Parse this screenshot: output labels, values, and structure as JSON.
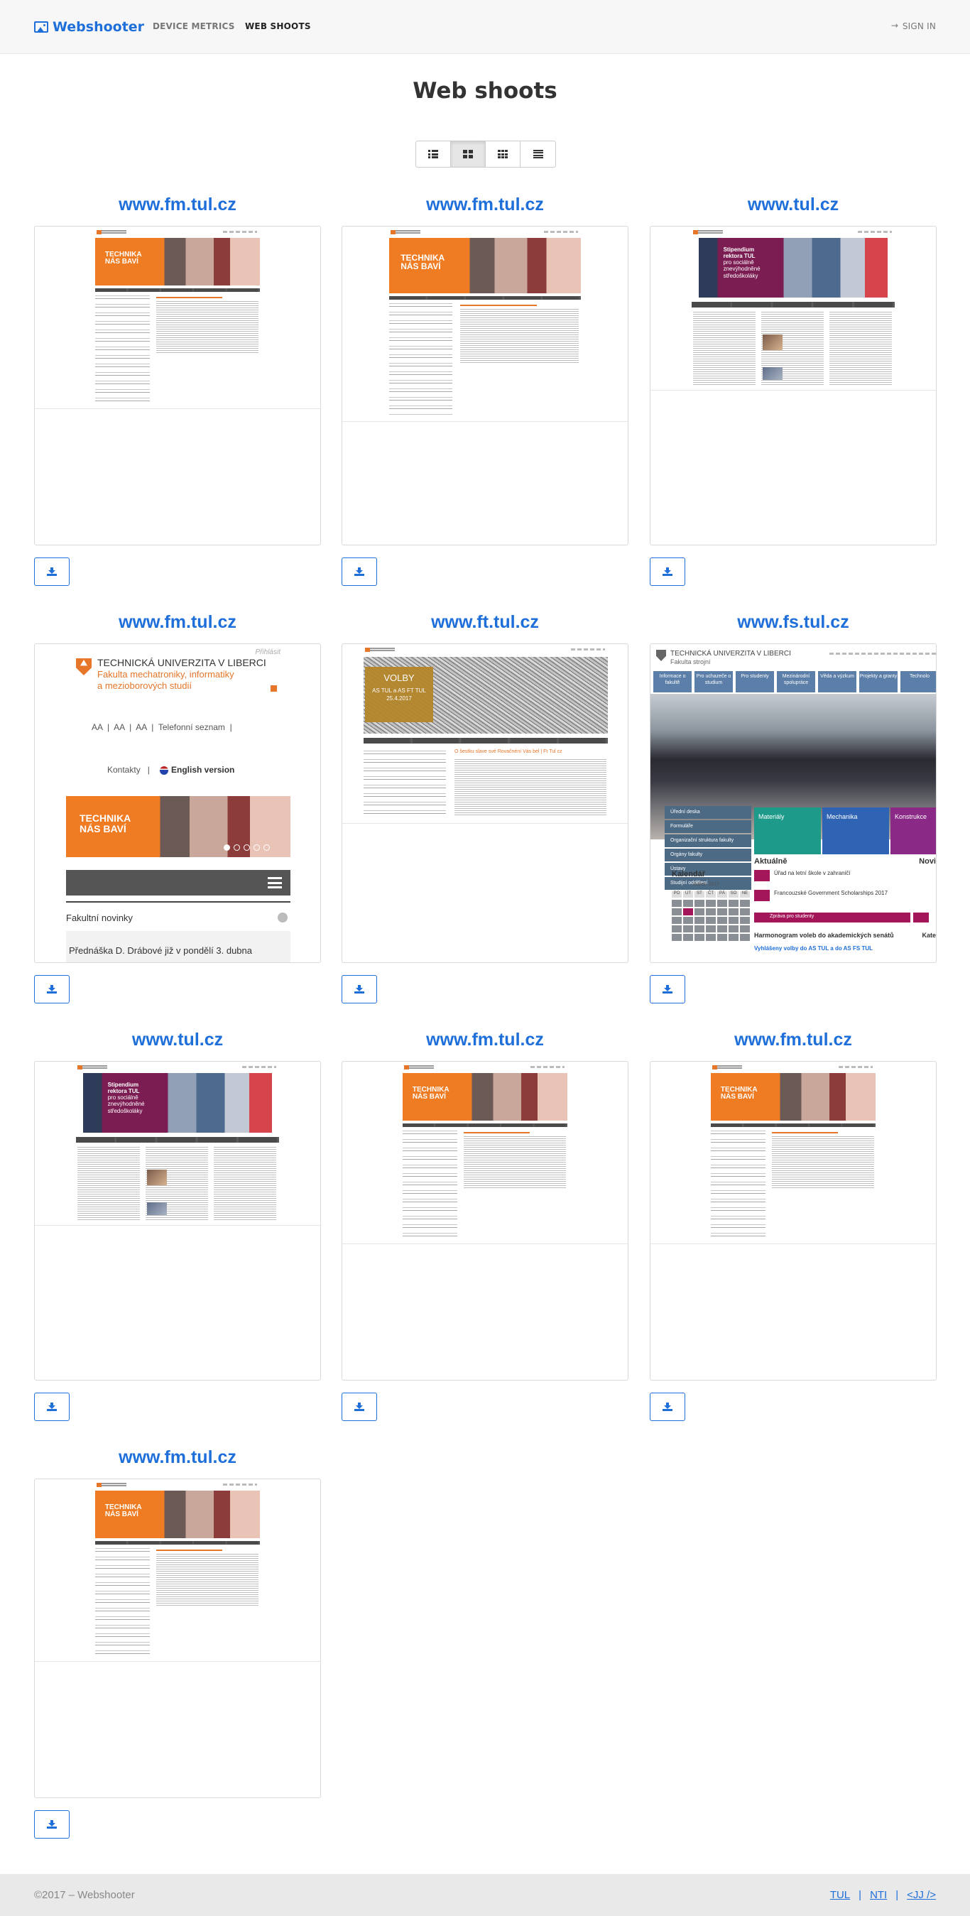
{
  "nav": {
    "brand": "Webshooter",
    "links": [
      {
        "label": "DEVICE METRICS"
      },
      {
        "label": "WEB SHOOTS"
      }
    ],
    "signin": "SIGN IN"
  },
  "page": {
    "title": "Web shoots"
  },
  "view_toggle": {
    "options": [
      "list",
      "grid-2",
      "grid-3",
      "lines"
    ],
    "selected": "grid-2"
  },
  "shoots": [
    {
      "title": "www.fm.tul.cz",
      "preview": "fm-desktop-small"
    },
    {
      "title": "www.fm.tul.cz",
      "preview": "fm-desktop"
    },
    {
      "title": "www.tul.cz",
      "preview": "tul-desktop"
    },
    {
      "title": "www.fm.tul.cz",
      "preview": "fm-mobile"
    },
    {
      "title": "www.ft.tul.cz",
      "preview": "ft-desktop"
    },
    {
      "title": "www.fs.tul.cz",
      "preview": "fs-desktop"
    },
    {
      "title": "www.tul.cz",
      "preview": "tul-desktop"
    },
    {
      "title": "www.fm.tul.cz",
      "preview": "fm-desktop-small"
    },
    {
      "title": "www.fm.tul.cz",
      "preview": "fm-desktop-small"
    },
    {
      "title": "www.fm.tul.cz",
      "preview": "fm-desktop-small"
    }
  ],
  "previews": {
    "fm_banner_text": "TECHNIKA\nNÁS BAVÍ",
    "tul_banner_text": "Stipendium\nrektora TUL\npro sociálně\nznevýhodněné\nstředoškoláky",
    "fm_mobile": {
      "uni": "TECHNICKÁ UNIVERZITA V LIBERCI",
      "faculty": "Fakulta mechatroniky, informatiky\na mezioborových studií",
      "prihlasit": "Přihlásit",
      "tools": [
        "A",
        "A",
        "A",
        "Telefonní seznam"
      ],
      "kontakty": "Kontakty",
      "english": "English version",
      "novinky": "Fakultní novinky",
      "news": "Přednáška D. Drábové již v pondělí 3. dubna"
    },
    "ft": {
      "volby": "VOLBY",
      "volby_sub": "AS TUL a AS FT TUL\n25.4.2017",
      "headline": "O šestku slave své Rovačnéní Vás bel | Ft Tul cz"
    },
    "fs": {
      "uni": "TECHNICKÁ UNIVERZITA V LIBERCI",
      "faculty": "Fakulta strojní",
      "tabs": [
        "Informace o fakultě",
        "Pro uchazeče o studium",
        "Pro studenty",
        "Mezinárodní spolupráce",
        "Věda a výzkum",
        "Projekty a granty",
        "Technolo"
      ],
      "menu": [
        "Úřední deska",
        "Formuláře",
        "Organizační struktura fakulty",
        "Orgány fakulty",
        "Ústavy",
        "Studijní oddělení"
      ],
      "tiles": [
        "Materiály",
        "Mechanika",
        "Konstrukce"
      ],
      "aktualne": "Aktuálně",
      "kalendar": "Kalendář",
      "month": "duben 2017",
      "days": [
        "PO",
        "ÚT",
        "ST",
        "ČT",
        "PÁ",
        "SO",
        "NE"
      ],
      "news": [
        "Úřad na letní škole v zahraničí",
        "Francouzské Government Scholarships 2017"
      ],
      "studenty": "Zpráva pro studenty",
      "harmonogram": "Harmonogram voleb do akademických senátů",
      "vyhlaseni": "Vyhlášeny volby do AS TUL a do AS FS TUL",
      "novinky": "Novi",
      "kate": "Kate"
    }
  },
  "footer": {
    "copyright": "©2017 – Webshooter",
    "links": [
      "TUL",
      "NTI",
      "<JJ />"
    ]
  }
}
